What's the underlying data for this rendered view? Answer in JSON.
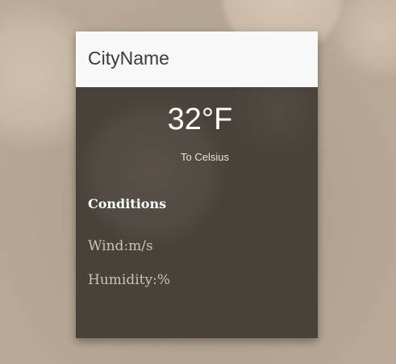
{
  "card": {
    "city_name": "CityName",
    "temperature": "32°F",
    "toggle_unit_label": "To Celsius",
    "conditions_heading": "Conditions",
    "wind_label": "Wind:m/s",
    "humidity_label": "Humidity:%"
  },
  "colors": {
    "header_background": "#f8f8f8",
    "body_background": "#48423b",
    "page_background": "#b7a896",
    "temperature_text": "#ffffff"
  }
}
